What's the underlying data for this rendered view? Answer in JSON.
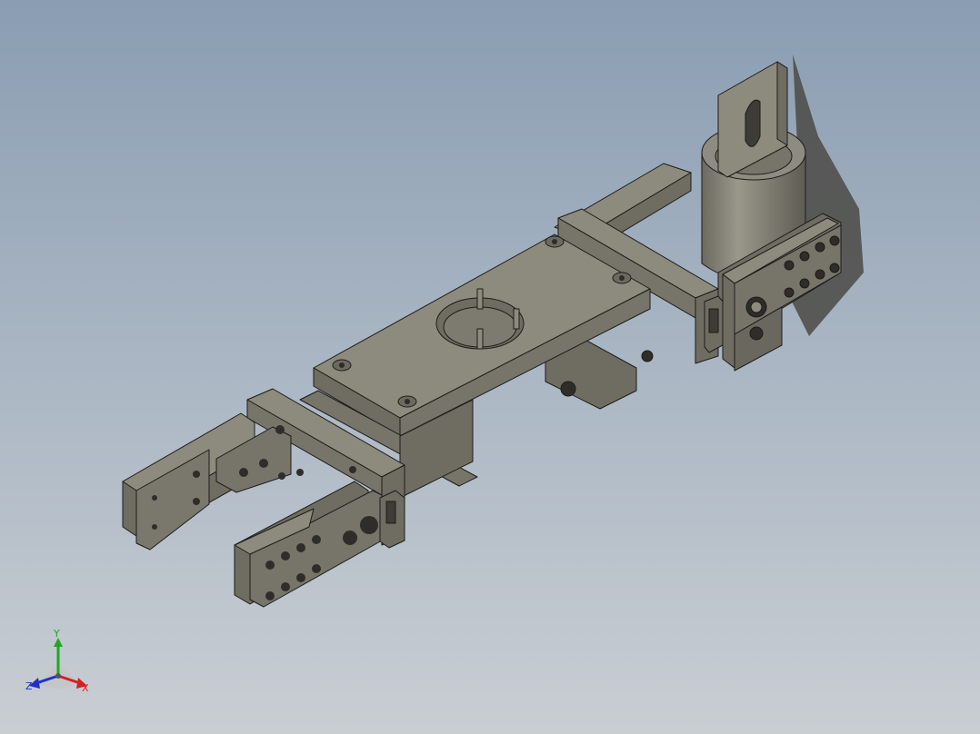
{
  "viewport": {
    "background_top": "#8a9db2",
    "background_bottom": "#c9ced3",
    "part_face_top": "#8d8b7e",
    "part_face_side": "#6f6d62",
    "part_face_dark": "#58574e",
    "edge_color": "#1c1c1a"
  },
  "triad": {
    "x_label": "X",
    "y_label": "Y",
    "z_label": "Z",
    "x_color": "#d42020",
    "y_color": "#1fa81f",
    "z_color": "#2030c8"
  }
}
